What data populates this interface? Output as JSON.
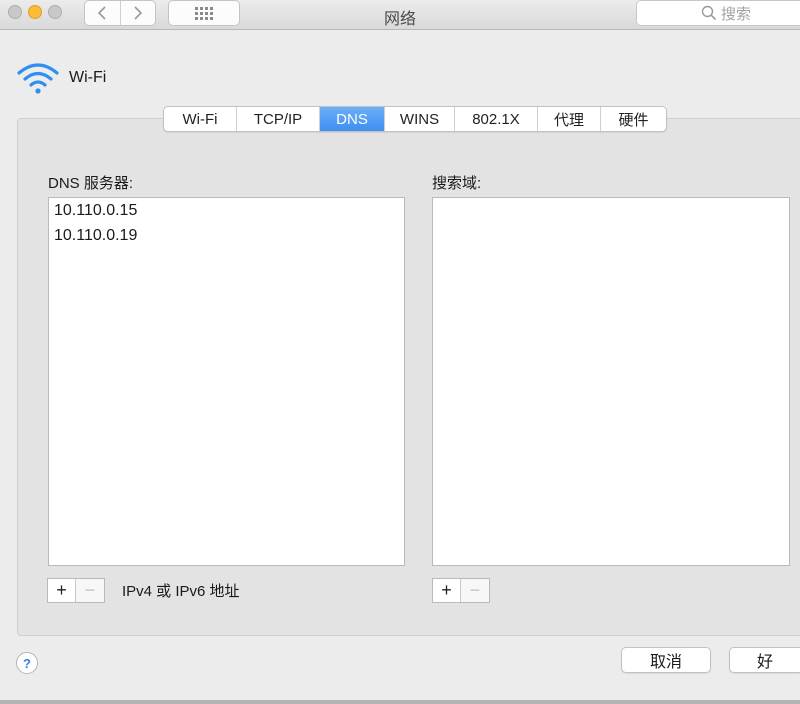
{
  "window": {
    "title": "网络"
  },
  "toolbar": {
    "search_placeholder": "搜索"
  },
  "header": {
    "interface_name": "Wi-Fi"
  },
  "tabs": [
    {
      "label": "Wi-Fi",
      "active": false
    },
    {
      "label": "TCP/IP",
      "active": false
    },
    {
      "label": "DNS",
      "active": true
    },
    {
      "label": "WINS",
      "active": false
    },
    {
      "label": "802.1X",
      "active": false
    },
    {
      "label": "代理",
      "active": false
    },
    {
      "label": "硬件",
      "active": false
    }
  ],
  "dns": {
    "label": "DNS 服务器:",
    "servers": [
      "10.110.0.15",
      "10.110.0.19"
    ],
    "hint": "IPv4 或 IPv6 地址"
  },
  "search_domains": {
    "label": "搜索域:",
    "items": []
  },
  "controls": {
    "plus": "+",
    "minus": "−"
  },
  "footer": {
    "help": "?",
    "cancel_label": "取消",
    "ok_label": "好"
  },
  "colors": {
    "accent": "#3e8ef2",
    "background": "#ececec"
  }
}
